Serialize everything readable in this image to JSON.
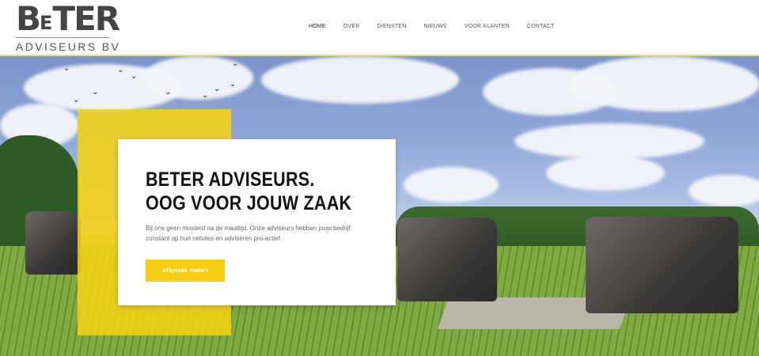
{
  "brand": {
    "logo_b": "B",
    "logo_e": "E",
    "logo_ter": "TER",
    "logo_subtitle": "ADVISEURS BV"
  },
  "nav": {
    "items": [
      {
        "label": "HOME"
      },
      {
        "label": "OVER"
      },
      {
        "label": "DIENSTEN"
      },
      {
        "label": "NIEUWS"
      },
      {
        "label": "VOOR KLANTEN"
      },
      {
        "label": "CONTACT"
      }
    ]
  },
  "hero": {
    "title_line1": "BETER ADVISEURS.",
    "title_line2": "OOG VOOR JOUW ZAAK",
    "text": "Bij ons geen mosterd na de maaltijd. Onze adviseurs hebben jouw bedrijf constant op hun netvlies en adviseren pro-actief.",
    "cta_label": "Afspraak maken"
  },
  "colors": {
    "accent": "#f6d010",
    "text_dark": "#111111"
  }
}
